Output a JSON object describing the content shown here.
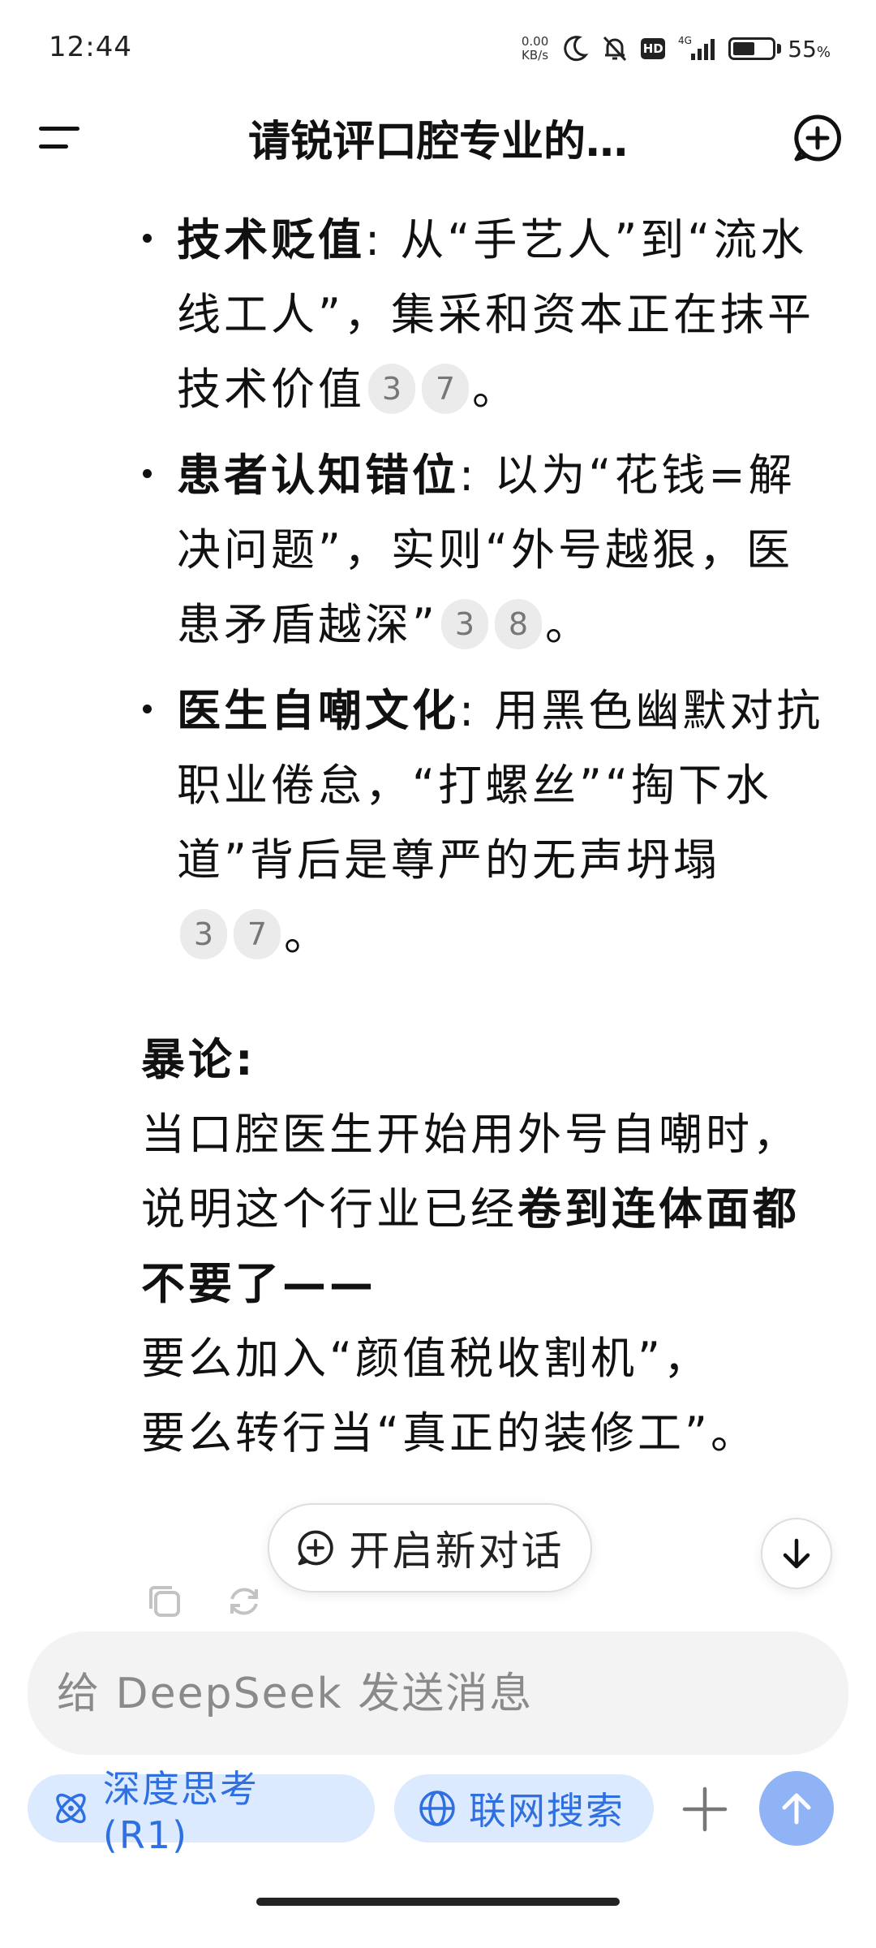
{
  "status_bar": {
    "time": "12:44",
    "net_speed_value": "0.00",
    "net_speed_unit": "KB/s",
    "network": "4G",
    "hd_badge": "HD",
    "battery_percent": "55",
    "battery_level": 0.55
  },
  "header": {
    "title": "请锐评口腔专业的…"
  },
  "bullets": [
    {
      "bold": "技术贬值",
      "text": ": 从“手艺人”到“流水线工人”，集采和资本正在抹平技术价值",
      "cite1": "3",
      "cite2": "7",
      "end": "。"
    },
    {
      "bold": "患者认知错位",
      "text": ": 以为“花钱=解决问题”，实则“外号越狠，医患矛盾越深”",
      "cite1": "3",
      "cite2": "8",
      "end": "。"
    },
    {
      "bold": "医生自嘲文化",
      "text": ": 用黑色幽默对抗职业倦怠，“打螺丝”“掏下水道”背后是尊严的无声坍塌",
      "cite1": "3",
      "cite2": "7",
      "end": "。"
    }
  ],
  "conclusion": {
    "heading": "暴论:",
    "line1": "当口腔医生开始用外号自嘲时，",
    "line2_prefix": "说明这个行业已经",
    "line2_bold": "卷到连体面都不要了——",
    "line3": "要么加入“颜值税收割机”，",
    "line4": "要么转行当“真正的装修工”。"
  },
  "new_chat_pill": {
    "label": "开启新对话"
  },
  "composer": {
    "placeholder": "给 DeepSeek 发送消息",
    "value": ""
  },
  "toolbar": {
    "deep_think_label": "深度思考 (R1)",
    "web_search_label": "联网搜索"
  },
  "colors": {
    "accent": "#2f6fe0",
    "chip_bg": "#dbeafe",
    "send_button": "#8fb3f5",
    "citation_bg": "#ebebeb"
  },
  "icons": {
    "menu": "menu-icon",
    "new_chat": "new-chat-icon",
    "copy": "copy-icon",
    "regenerate": "regenerate-icon",
    "scroll_down": "arrow-down-icon",
    "deep_think": "atom-icon",
    "web_search": "globe-icon",
    "plus": "plus-icon",
    "send": "arrow-up-icon"
  }
}
